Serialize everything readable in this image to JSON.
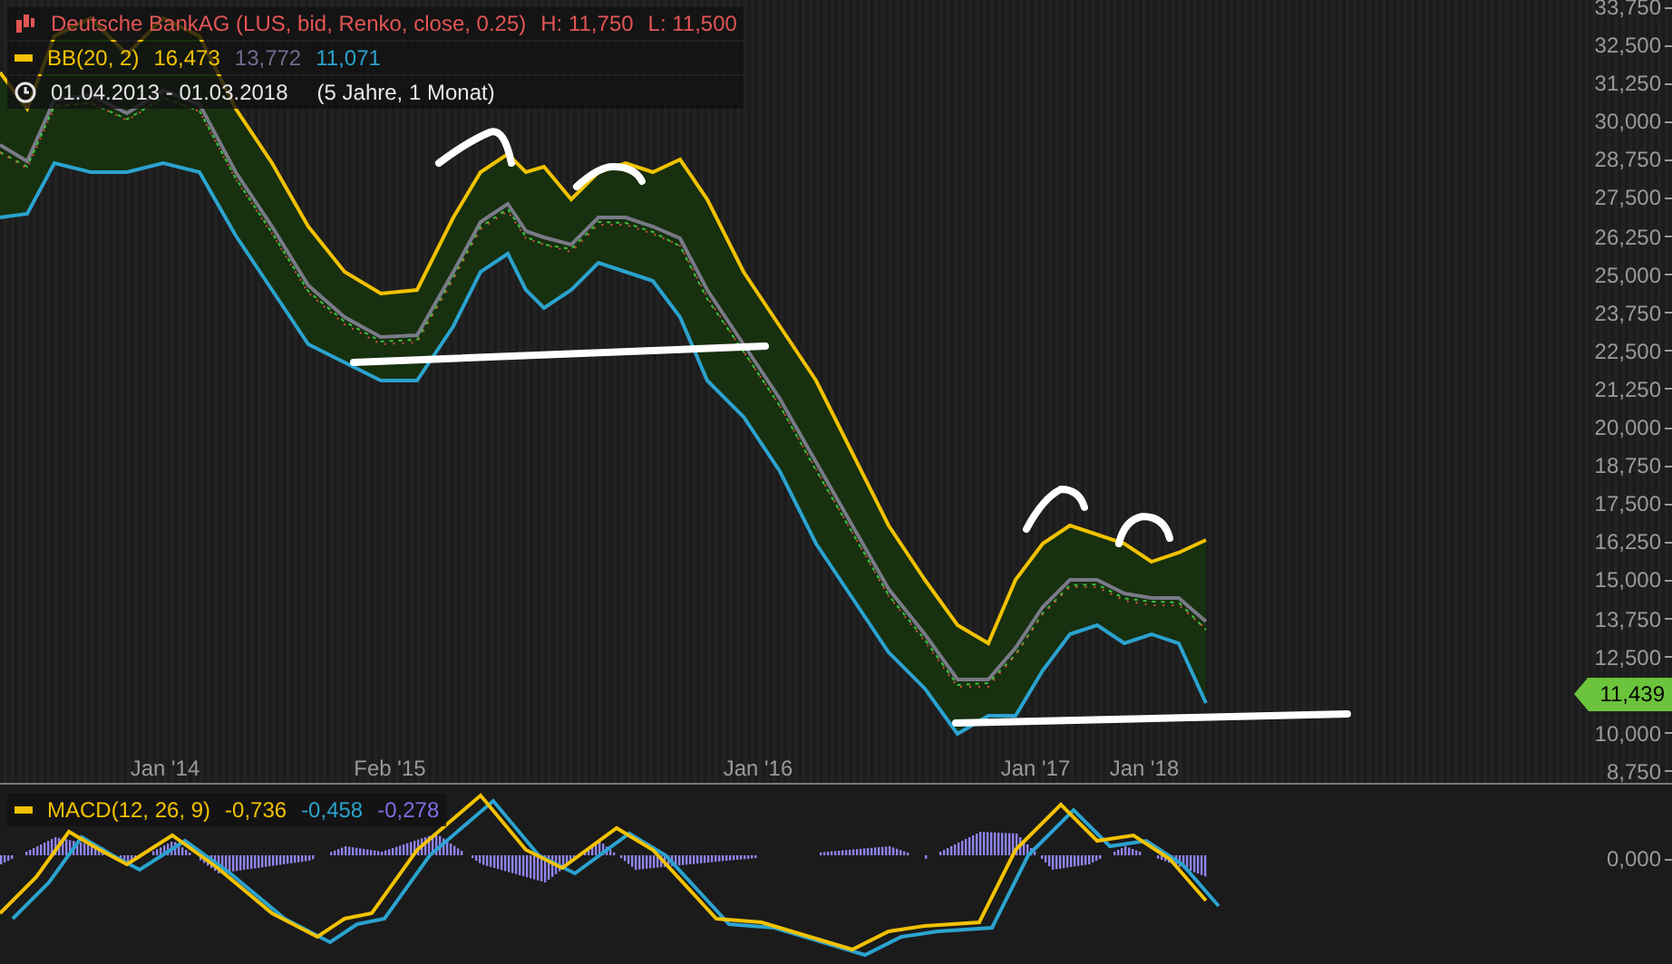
{
  "legend": {
    "title": "Deutsche BankAG (LUS, bid, Renko, close, 0.25)",
    "high": "H: 11,750",
    "low": "L: 11,500"
  },
  "bollinger": {
    "label": "BB(20, 2)",
    "values": [
      {
        "text": "16,473",
        "color": "#f2c200"
      },
      {
        "text": "13,772",
        "color": "#6e6e8e"
      },
      {
        "text": "11,071",
        "color": "#2ba3cf"
      }
    ]
  },
  "period": {
    "range": "01.04.2013 - 01.03.2018",
    "duration": "(5 Jahre, 1 Monat)"
  },
  "price_axis": {
    "ticks_above_price": [
      "33,750",
      "32,500",
      "31,250",
      "30,000",
      "28,750",
      "27,500",
      "26,250",
      "25,000",
      "23,750",
      "22,500",
      "21,250",
      "20,000",
      "18,750",
      "17,500",
      "16,250",
      "15,000",
      "13,750",
      "12,500"
    ],
    "ticks_below_price": [
      "10,000",
      "8,750"
    ]
  },
  "current_price": "11,439",
  "date_axis": {
    "labels": [
      "Jan '14",
      "Feb '15",
      "Jan '16",
      "Jan '17",
      "Jan '18"
    ]
  },
  "macd": {
    "label": "MACD(12, 26, 9)",
    "values": [
      {
        "text": "-0,736",
        "color": "#f2c200"
      },
      {
        "text": "-0,458",
        "color": "#2ba3cf"
      },
      {
        "text": "-0,278",
        "color": "#7b6fe0"
      }
    ],
    "axis_tick": "0,000"
  }
}
